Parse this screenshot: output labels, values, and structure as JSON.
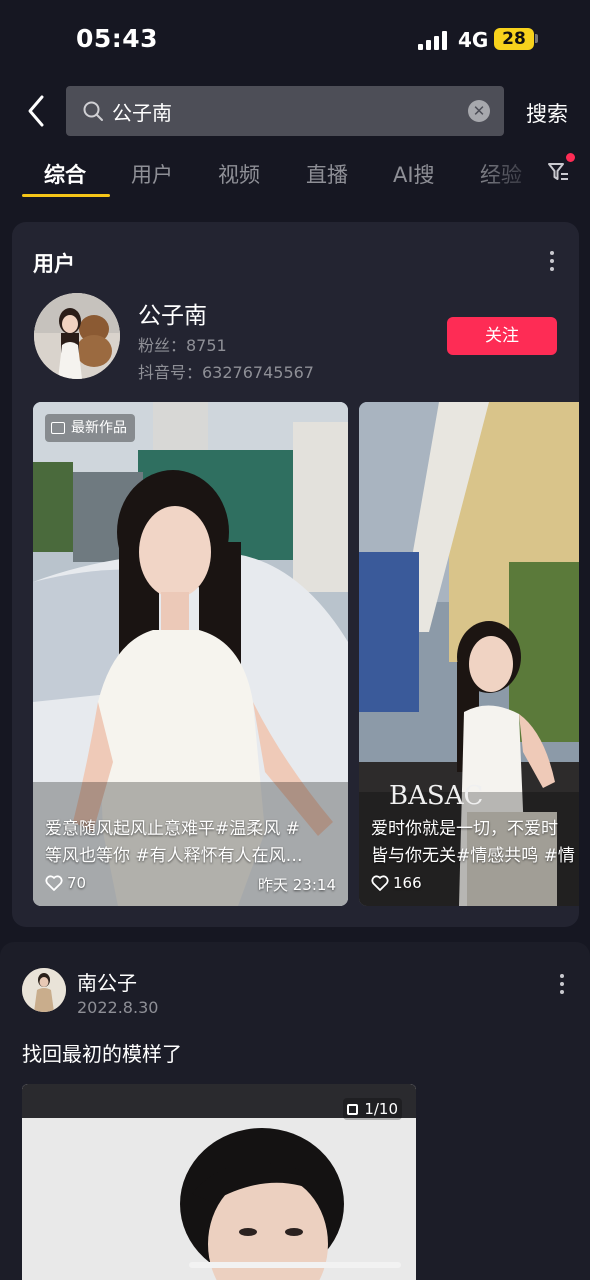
{
  "status_bar": {
    "time": "05:43",
    "network": "4G",
    "battery": "28"
  },
  "search": {
    "query": "公子南",
    "placeholder": "",
    "submit_label": "搜索"
  },
  "tabs": [
    {
      "label": "综合",
      "active": true
    },
    {
      "label": "用户",
      "active": false
    },
    {
      "label": "视频",
      "active": false
    },
    {
      "label": "直播",
      "active": false
    },
    {
      "label": "AI搜",
      "active": false
    },
    {
      "label": "经验",
      "active": false
    }
  ],
  "user_section": {
    "title": "用户",
    "user": {
      "name": "公子南",
      "fans": "粉丝：8751",
      "douyin_id": "抖音号：63276745567",
      "follow_label": "关注"
    },
    "videos": [
      {
        "badge": "最新作品",
        "caption_line1": "爱意随风起风止意难平#温柔风 #",
        "caption_line2": "等风也等你 #有人释怀有人在风…",
        "likes": "70",
        "date": "昨天 23:14"
      },
      {
        "badge": "",
        "caption_line1": "爱时你就是一切，不爱时",
        "caption_line2": "皆与你无关#情感共鸣 #情",
        "likes": "166",
        "date": "",
        "sign_text": "BASAC"
      }
    ]
  },
  "post": {
    "author": "南公子",
    "date": "2022.8.30",
    "text": "找回最初的模样了",
    "image_count": "1/10"
  },
  "colors": {
    "accent_red": "#fe2c55",
    "tab_underline": "#f5c518",
    "background": "#161722",
    "card": "#232431"
  }
}
